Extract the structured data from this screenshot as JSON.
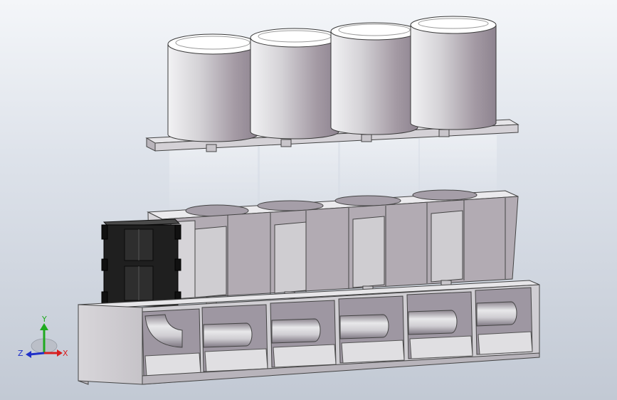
{
  "viewport": {
    "background_top": "#f4f6f9",
    "background_bottom": "#c2c9d4"
  },
  "model": {
    "cylinders": 4,
    "block_bores": 4,
    "manifold_bays": 6,
    "body_color": "#b5adb5",
    "cap_color": "#d6d6d9",
    "bracket_color": "#1f1f1f"
  },
  "triad": {
    "x_label": "X",
    "y_label": "Y",
    "z_label": "Z",
    "x_color": "#d82020",
    "y_color": "#1faa1f",
    "z_color": "#2030c8"
  }
}
